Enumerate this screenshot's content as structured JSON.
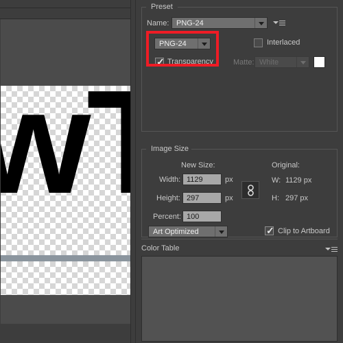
{
  "app": {
    "name": "save-for-web-dialog",
    "background_color": "#3d3d3d",
    "accent_highlight_color": "#ef1c25"
  },
  "preview": {
    "artwork_text": "wTe",
    "transparency_checkerboard": true,
    "divider_bar_color": "#8b959e",
    "canvas_background": "#ffffff",
    "checker_color": "#d6d6d6"
  },
  "preset_panel": {
    "title": "Preset",
    "name_label": "Name:",
    "name_value": "PNG-24",
    "flyout_icon": "flyout-menu-icon",
    "format_value": "PNG-24",
    "transparency": {
      "label": "Transparency",
      "checked": true,
      "check_glyph": "✓"
    },
    "interlaced": {
      "label": "Interlaced",
      "checked": false
    },
    "matte": {
      "label": "Matte:",
      "value": "White",
      "enabled": false,
      "swatch_color": "#ffffff"
    }
  },
  "image_size_panel": {
    "title": "Image Size",
    "new_size_label": "New Size:",
    "original_label": "Original:",
    "width_label": "Width:",
    "width_value": "1129",
    "width_unit": "px",
    "height_label": "Height:",
    "height_value": "297",
    "height_unit": "px",
    "percent_label": "Percent:",
    "percent_value": "100",
    "constrain_icon": "chain-link-icon",
    "original_width_label": "W:",
    "original_width_value": "1129 px",
    "original_height_label": "H:",
    "original_height_value": "297 px",
    "quality_value": "Art Optimized",
    "clip_to_artboard": {
      "label": "Clip to Artboard",
      "checked": true,
      "check_glyph": "✓"
    }
  },
  "color_table_panel": {
    "title": "Color Table",
    "flyout_icon": "flyout-menu-icon",
    "entries": []
  }
}
